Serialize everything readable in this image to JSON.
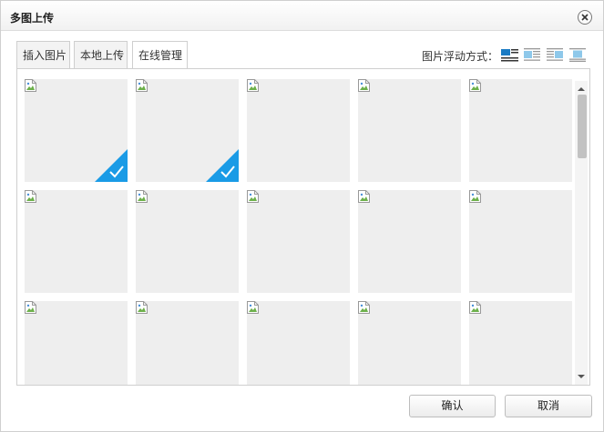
{
  "dialog": {
    "title": "多图上传"
  },
  "tabs": [
    {
      "label": "插入图片",
      "active": false
    },
    {
      "label": "本地上传",
      "active": false
    },
    {
      "label": "在线管理",
      "active": true
    }
  ],
  "float": {
    "label": "图片浮动方式：",
    "options": [
      "none",
      "left",
      "right",
      "center"
    ],
    "selected": "none"
  },
  "images": [
    {
      "selected": true
    },
    {
      "selected": true
    },
    {
      "selected": false
    },
    {
      "selected": false
    },
    {
      "selected": false
    },
    {
      "selected": false
    },
    {
      "selected": false
    },
    {
      "selected": false
    },
    {
      "selected": false
    },
    {
      "selected": false
    },
    {
      "selected": false
    },
    {
      "selected": false
    },
    {
      "selected": false
    },
    {
      "selected": false
    },
    {
      "selected": false
    }
  ],
  "footer": {
    "ok_label": "确认",
    "cancel_label": "取消"
  },
  "colors": {
    "accent": "#1a9be6",
    "thumb_bg": "#eeeeee"
  }
}
